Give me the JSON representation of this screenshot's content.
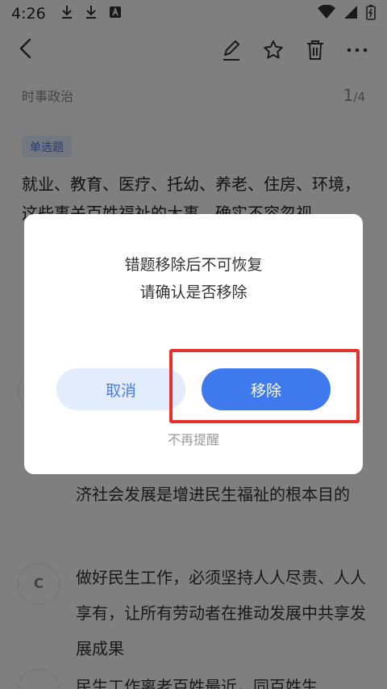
{
  "status_bar": {
    "time": "4:26",
    "icons_left": [
      "download-icon",
      "download-icon",
      "font-app-icon"
    ],
    "icons_right": [
      "wifi-icon",
      "signal-icon",
      "battery-charging-icon"
    ]
  },
  "toolbar": {
    "icons": [
      "back-icon",
      "edit-icon",
      "star-icon",
      "trash-icon",
      "more-icon"
    ]
  },
  "question": {
    "category": "时事政治",
    "page_current": "1",
    "page_total": "/4",
    "type_tag": "单选题",
    "text": "就业、教育、医疗、托幼、养老、住房、环境，这些事关百姓福祉的大事，确实不容忽视"
  },
  "options": [
    {
      "letter": "",
      "text": "济社会发展是增进民生福祉的根本目的"
    },
    {
      "letter": "C",
      "text": "做好民生工作，必须坚持人人尽责、人人享有，让所有劳动者在推动发展中共享发展成果"
    },
    {
      "letter": "",
      "text": "民生工作离老百姓最近，同百姓生"
    }
  ],
  "dialog": {
    "message_line1": "错题移除后不可恢复",
    "message_line2": "请确认是否移除",
    "cancel_label": "取消",
    "remove_label": "移除",
    "no_remind_label": "不再提醒"
  },
  "colors": {
    "accent": "#3e79ee",
    "cancel_bg": "#e3ecfd",
    "highlight": "#e8312a",
    "tag_bg": "#e7efff"
  }
}
